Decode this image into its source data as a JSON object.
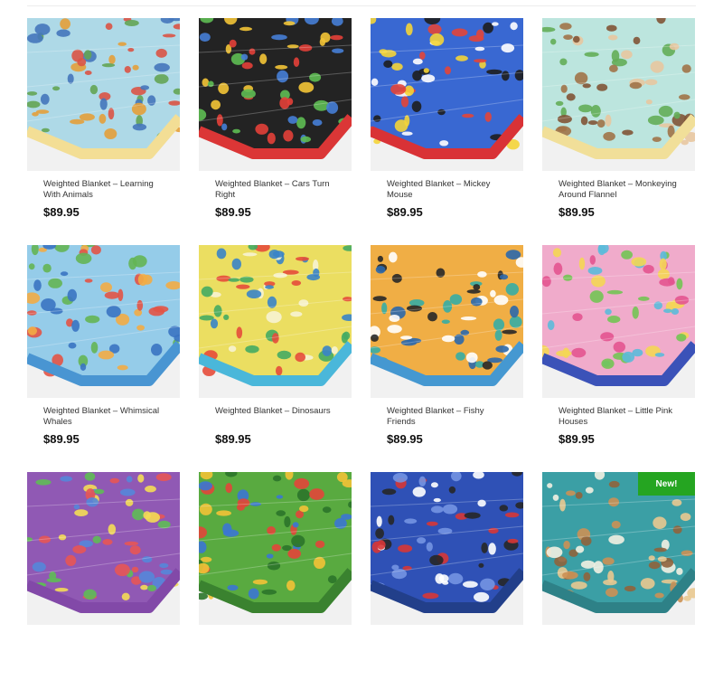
{
  "products": [
    {
      "title": "Weighted Blanket – Learning With Animals",
      "price": "$89.95",
      "image": "learning-with-animals-blanket-image",
      "bg": "#a9d7e6",
      "accent": "#f3dc8f",
      "dots": [
        "#d84a3a",
        "#5aa04a",
        "#3a6fb8",
        "#e39a2d"
      ]
    },
    {
      "title": "Weighted Blanket – Cars Turn Right",
      "price": "$89.95",
      "image": "cars-turn-right-blanket-image",
      "bg": "#161616",
      "accent": "#d92a2a",
      "dots": [
        "#e2342c",
        "#3b77d4",
        "#f2c12a",
        "#54b848"
      ]
    },
    {
      "title": "Weighted Blanket – Mickey Mouse",
      "price": "$89.95",
      "image": "mickey-mouse-blanket-image",
      "bg": "#2d5fd0",
      "accent": "#d7262a",
      "dots": [
        "#111111",
        "#e23a2c",
        "#f4d12b",
        "#ffffff"
      ]
    },
    {
      "title": "Weighted Blanket – Monkeying Around Flannel",
      "price": "$89.95",
      "image": "monkeying-around-blanket-image",
      "bg": "#b8e4dc",
      "accent": "#f1de93",
      "dots": [
        "#7a4a2a",
        "#5aa84e",
        "#9b6a3d",
        "#e7c39a"
      ]
    },
    {
      "title": "Weighted Blanket – Whimsical Whales",
      "price": "$89.95",
      "image": "whimsical-whales-blanket-image",
      "bg": "#8fc9e8",
      "accent": "#3e8fd0",
      "dots": [
        "#e14a3b",
        "#5bb04a",
        "#2f6bbf",
        "#f2a73a"
      ]
    },
    {
      "title": "Weighted Blanket – Dinosaurs",
      "price": "$89.95",
      "image": "dinosaurs-blanket-image",
      "bg": "#eadc58",
      "accent": "#3fb3d8",
      "dots": [
        "#e4412f",
        "#3aa65a",
        "#2d7cc4",
        "#f7f3d0"
      ]
    },
    {
      "title": "Weighted Blanket – Fishy Friends",
      "price": "$89.95",
      "image": "fishy-friends-blanket-image",
      "bg": "#f0a93a",
      "accent": "#3a92cf",
      "dots": [
        "#1f5fa7",
        "#2aa7a0",
        "#ffffff",
        "#1b1b1b"
      ]
    },
    {
      "title": "Weighted Blanket – Little Pink Houses",
      "price": "$89.95",
      "image": "little-pink-houses-blanket-image",
      "bg": "#f0a6c8",
      "accent": "#2f48b4",
      "dots": [
        "#e24a8a",
        "#52b7d8",
        "#6bc24a",
        "#f4d54a"
      ]
    },
    {
      "title": "",
      "price": "",
      "image": "letters-purple-blanket-image",
      "bg": "#8a4fb0",
      "accent": "#7b3ea3",
      "dots": [
        "#f3d94b",
        "#e44b4b",
        "#55b84c",
        "#4a7fd8"
      ]
    },
    {
      "title": "",
      "price": "",
      "image": "ninja-turtles-blanket-image",
      "bg": "#4fa535",
      "accent": "#2e7b22",
      "dots": [
        "#1f6d1d",
        "#e13a2e",
        "#2f6ed0",
        "#f2c02a"
      ]
    },
    {
      "title": "",
      "price": "",
      "image": "spiderman-blanket-image",
      "bg": "#2247b2",
      "accent": "#153383",
      "dots": [
        "#d52a2a",
        "#1a1a1a",
        "#6b8de0",
        "#ffffff"
      ]
    },
    {
      "title": "",
      "price": "",
      "image": "dinosaur-teal-blanket-image",
      "badge": "New!",
      "bg": "#2f9aa0",
      "accent": "#217a80",
      "dots": [
        "#c98b4a",
        "#e8c58a",
        "#8a5a30",
        "#f2efe0"
      ]
    }
  ]
}
